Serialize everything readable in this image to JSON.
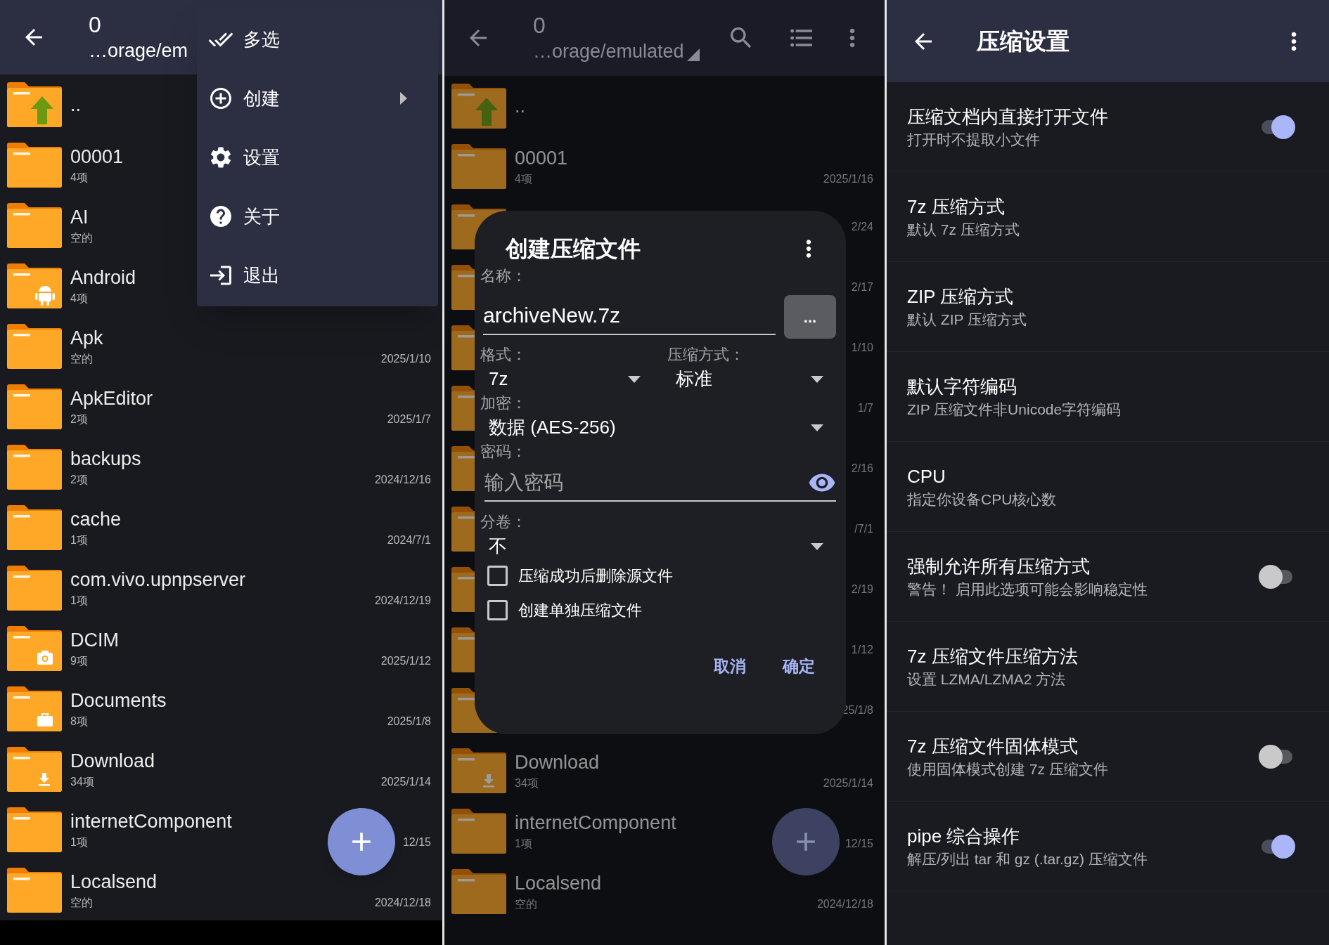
{
  "file_browser": {
    "title": "0",
    "path": "…orage/em",
    "items": [
      {
        "name": "..",
        "kind": "up"
      },
      {
        "name": "00001",
        "info": "4项",
        "kind": "plain"
      },
      {
        "name": "AI",
        "info": "空的",
        "kind": "plain"
      },
      {
        "name": "Android",
        "info": "4项",
        "kind": "android"
      },
      {
        "name": "Apk",
        "info": "空的",
        "date": "2025/1/10",
        "kind": "plain"
      },
      {
        "name": "ApkEditor",
        "info": "2项",
        "date": "2025/1/7",
        "kind": "plain"
      },
      {
        "name": "backups",
        "info": "2项",
        "date": "2024/12/16",
        "kind": "plain"
      },
      {
        "name": "cache",
        "info": "1项",
        "date": "2024/7/1",
        "kind": "plain"
      },
      {
        "name": "com.vivo.upnpserver",
        "info": "1项",
        "date": "2024/12/19",
        "kind": "plain"
      },
      {
        "name": "DCIM",
        "info": "9项",
        "date": "2025/1/12",
        "kind": "camera"
      },
      {
        "name": "Documents",
        "info": "8项",
        "date": "2025/1/8",
        "kind": "briefcase"
      },
      {
        "name": "Download",
        "info": "34项",
        "date": "2025/1/14",
        "kind": "download"
      },
      {
        "name": "internetComponent",
        "info": "1项",
        "date": "12/15",
        "kind": "plain"
      },
      {
        "name": "Localsend",
        "info": "空的",
        "date": "2024/12/18",
        "kind": "plain"
      }
    ]
  },
  "overflow_menu": {
    "items": [
      {
        "label": "多选",
        "kind": "double-check",
        "submenu": false
      },
      {
        "label": "创建",
        "kind": "plus-circle",
        "submenu": true
      },
      {
        "label": "设置",
        "kind": "gear",
        "submenu": false
      },
      {
        "label": "关于",
        "kind": "help",
        "submenu": false
      },
      {
        "label": "退出",
        "kind": "exit",
        "submenu": false
      }
    ]
  },
  "archive_screen": {
    "title": "0",
    "path": "…orage/emulated",
    "items": [
      {
        "name": "..",
        "kind": "up"
      },
      {
        "name": "00001",
        "info": "4项",
        "date": "2025/1/16",
        "kind": "plain"
      },
      {
        "date": "2/24",
        "kind": "plain"
      },
      {
        "date": "2/17",
        "kind": "plain"
      },
      {
        "date": "1/10",
        "kind": "plain"
      },
      {
        "date": "1/7",
        "kind": "plain"
      },
      {
        "date": "2/16",
        "kind": "plain"
      },
      {
        "date": "/7/1",
        "kind": "plain"
      },
      {
        "date": "2/19",
        "kind": "plain"
      },
      {
        "date": "1/12",
        "kind": "plain"
      },
      {
        "date": "25/1/8",
        "kind": "plain"
      },
      {
        "name": "Download",
        "info": "34项",
        "date": "2025/1/14",
        "kind": "download"
      },
      {
        "name": "internetComponent",
        "info": "1项",
        "date": "12/15",
        "kind": "plain"
      },
      {
        "name": "Localsend",
        "info": "空的",
        "date": "2024/12/18",
        "kind": "plain"
      }
    ],
    "dialog": {
      "title": "创建压缩文件",
      "name_label": "名称：",
      "name_value": "archiveNew.7z",
      "browse_button": "...",
      "format_label": "格式：",
      "format_value": "7z",
      "method_label": "压缩方式：",
      "method_value": "标准",
      "encryption_label": "加密：",
      "encryption_value": "数据 (AES-256)",
      "password_label": "密码：",
      "password_placeholder": "输入密码",
      "split_label": "分卷：",
      "split_value": "不",
      "checkboxes": [
        {
          "label": "压缩成功后删除源文件",
          "checked": false
        },
        {
          "label": "创建单独压缩文件",
          "checked": false
        }
      ],
      "buttons": [
        "取消",
        "确定"
      ]
    }
  },
  "settings_screen": {
    "title": "压缩设置",
    "items": [
      {
        "title": "压缩文档内直接打开文件",
        "subtitle": "打开时不提取小文件",
        "kind": "toggle",
        "on": true
      },
      {
        "title": "7z 压缩方式",
        "subtitle": "默认 7z 压缩方式",
        "kind": "plain"
      },
      {
        "title": "ZIP 压缩方式",
        "subtitle": "默认 ZIP 压缩方式",
        "kind": "plain"
      },
      {
        "title": "默认字符编码",
        "subtitle": "ZIP 压缩文件非Unicode字符编码",
        "kind": "plain"
      },
      {
        "title": "CPU",
        "subtitle": "指定你设备CPU核心数",
        "kind": "plain"
      },
      {
        "title": "强制允许所有压缩方式",
        "subtitle": "警告！ 启用此选项可能会影响稳定性",
        "kind": "toggle",
        "on": false
      },
      {
        "title": "7z 压缩文件压缩方法",
        "subtitle": "设置 LZMA/LZMA2 方法",
        "kind": "plain"
      },
      {
        "title": "7z 压缩文件固体模式",
        "subtitle": "使用固体模式创建 7z 压缩文件",
        "kind": "toggle",
        "on": false
      },
      {
        "title": "pipe 综合操作",
        "subtitle": "解压/列出 tar 和 gz (.tar.gz) 压缩文件",
        "kind": "toggle",
        "on": true
      }
    ]
  }
}
